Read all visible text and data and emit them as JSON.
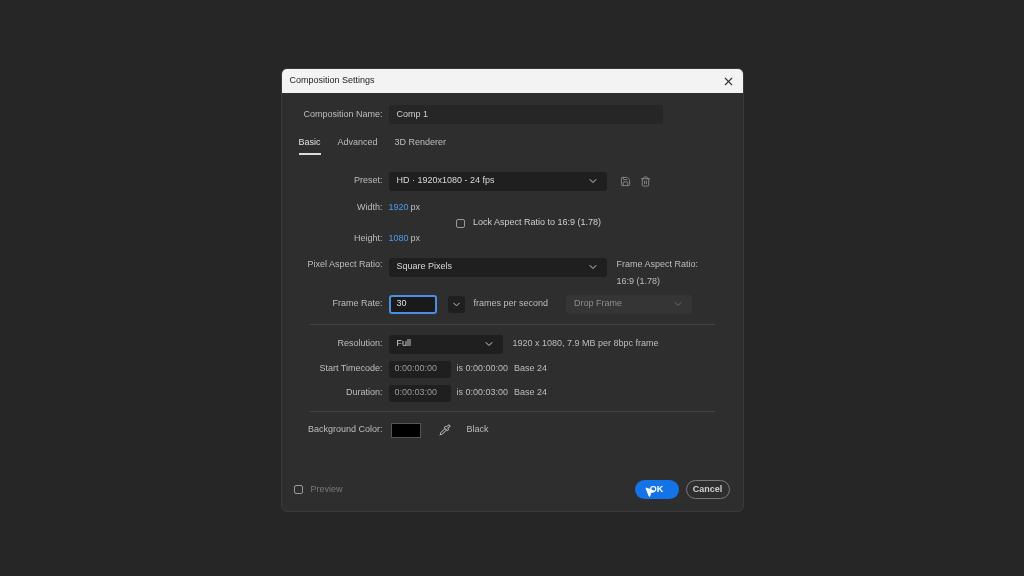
{
  "dialog": {
    "title": "Composition Settings"
  },
  "composition_name": {
    "label": "Composition Name:",
    "value": "Comp 1"
  },
  "tabs": [
    {
      "label": "Basic",
      "selected": true
    },
    {
      "label": "Advanced",
      "selected": false
    },
    {
      "label": "3D Renderer",
      "selected": false
    }
  ],
  "preset": {
    "label": "Preset:",
    "value": "HD  ·  1920x1080 - 24 fps"
  },
  "width": {
    "label": "Width:",
    "value": "1920",
    "unit": "px"
  },
  "height": {
    "label": "Height:",
    "value": "1080",
    "unit": "px"
  },
  "lock_aspect": {
    "label": "Lock Aspect Ratio to 16:9 (1.78)",
    "checked": false
  },
  "pixel_aspect_ratio": {
    "label": "Pixel Aspect Ratio:",
    "value": "Square Pixels"
  },
  "frame_aspect_ratio": {
    "label": "Frame Aspect Ratio:",
    "value": "16:9 (1.78)"
  },
  "frame_rate": {
    "label": "Frame Rate:",
    "value": "30",
    "focused": true,
    "unit": "frames per second",
    "drop_frame": {
      "value": "Drop Frame",
      "disabled": true
    }
  },
  "resolution": {
    "label": "Resolution:",
    "value": "Full",
    "info": "1920 x 1080, 7.9 MB per 8bpc frame"
  },
  "start_timecode": {
    "label": "Start Timecode:",
    "value": "0:00:00:00",
    "is": "is 0:00:00:00",
    "base": "Base 24"
  },
  "duration": {
    "label": "Duration:",
    "value": "0:00:03:00",
    "is": "is 0:00:03:00",
    "base": "Base 24"
  },
  "background_color": {
    "label": "Background Color:",
    "name": "Black"
  },
  "preview": {
    "label": "Preview",
    "checked": false
  },
  "buttons": [
    {
      "label": "OK",
      "kind": "primary"
    },
    {
      "label": "Cancel",
      "kind": "secondary"
    }
  ]
}
